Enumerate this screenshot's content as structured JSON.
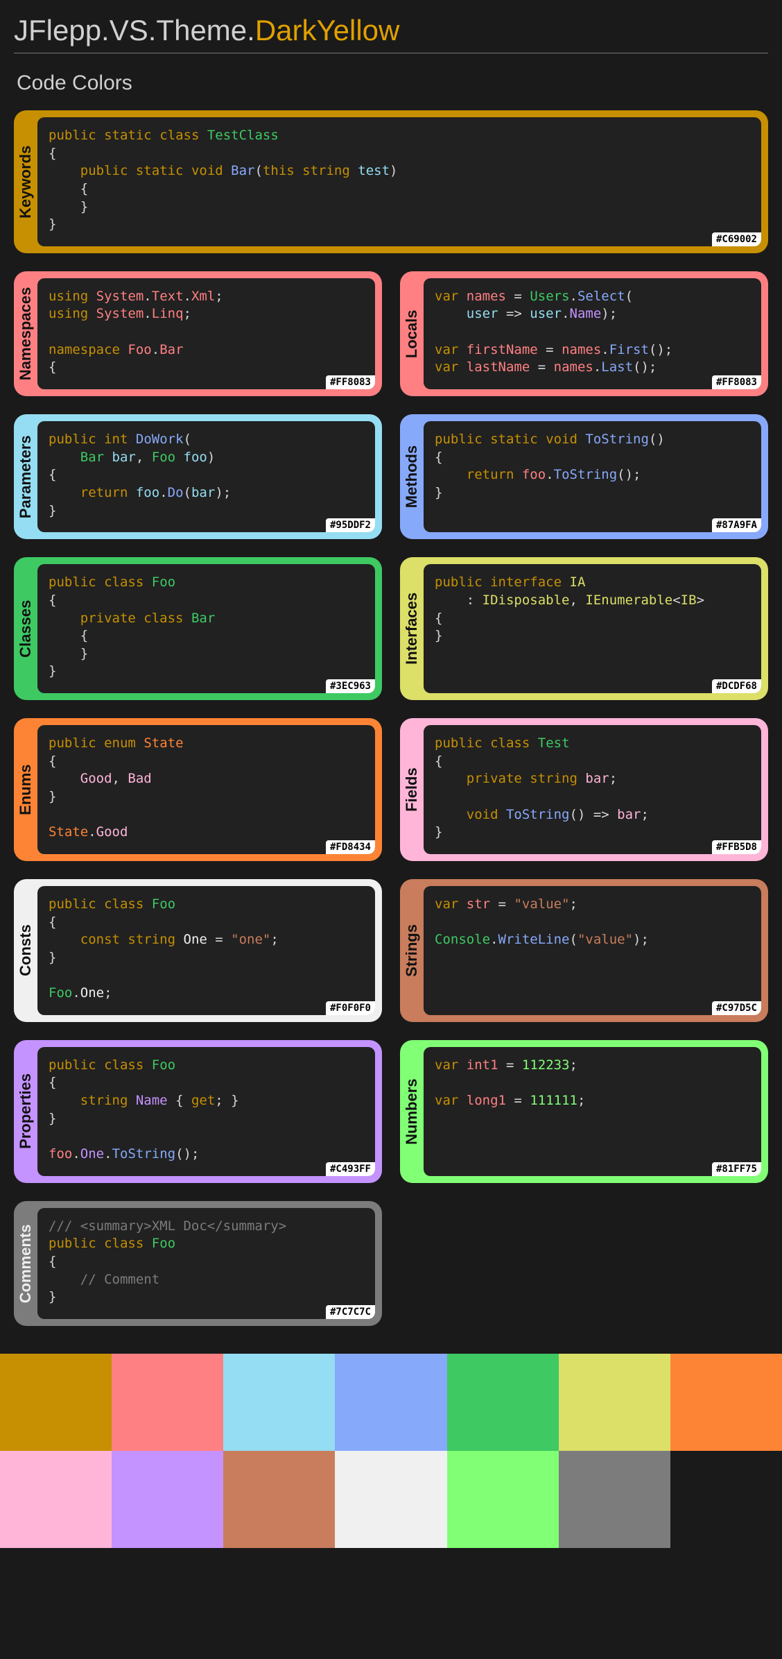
{
  "title_prefix": "JFlepp.VS.Theme.",
  "title_accent": "DarkYellow",
  "section": "Code Colors",
  "cards": {
    "keywords": {
      "label": "Keywords",
      "hex": "#C69002",
      "bg": "#C69002",
      "dark": true
    },
    "namespaces": {
      "label": "Namespaces",
      "hex": "#FF8083",
      "bg": "#FF8083",
      "dark": true
    },
    "locals": {
      "label": "Locals",
      "hex": "#FF8083",
      "bg": "#FF8083",
      "dark": true
    },
    "parameters": {
      "label": "Parameters",
      "hex": "#95DDF2",
      "bg": "#95DDF2",
      "dark": true
    },
    "methods": {
      "label": "Methods",
      "hex": "#87A9FA",
      "bg": "#87A9FA",
      "dark": true
    },
    "classes": {
      "label": "Classes",
      "hex": "#3EC963",
      "bg": "#3EC963",
      "dark": true
    },
    "interfaces": {
      "label": "Interfaces",
      "hex": "#DCDF68",
      "bg": "#DCDF68",
      "dark": true
    },
    "enums": {
      "label": "Enums",
      "hex": "#FD8434",
      "bg": "#FD8434",
      "dark": true
    },
    "fields": {
      "label": "Fields",
      "hex": "#FFB5D8",
      "bg": "#FFB5D8",
      "dark": true
    },
    "consts": {
      "label": "Consts",
      "hex": "#F0F0F0",
      "bg": "#F0F0F0",
      "dark": true
    },
    "strings": {
      "label": "Strings",
      "hex": "#C97D5C",
      "bg": "#C97D5C",
      "dark": true
    },
    "properties": {
      "label": "Properties",
      "hex": "#C493FF",
      "bg": "#C493FF",
      "dark": true
    },
    "numbers": {
      "label": "Numbers",
      "hex": "#81FF75",
      "bg": "#81FF75",
      "dark": true
    },
    "comments": {
      "label": "Comments",
      "hex": "#7C7C7C",
      "bg": "#7C7C7C",
      "dark": false
    }
  },
  "palette": [
    "#C69002",
    "#FF8083",
    "#95DDF2",
    "#87A9FA",
    "#3EC963",
    "#DCDF68",
    "#FD8434",
    "#FFB5D8",
    "#C493FF",
    "#C97D5C",
    "#F0F0F0",
    "#81FF75",
    "#7C7C7C",
    "#1a1a1a"
  ]
}
